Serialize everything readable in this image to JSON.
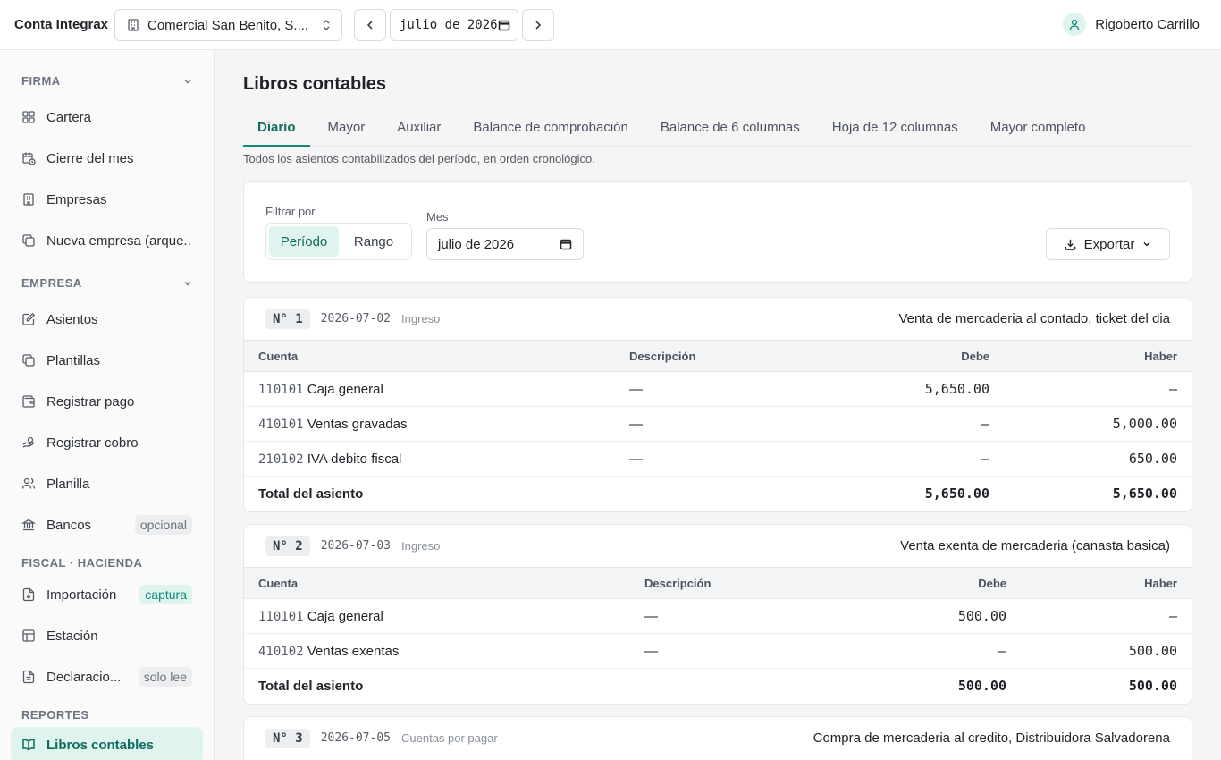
{
  "app": {
    "brand": "Conta Integrax"
  },
  "header": {
    "company": "Comercial San Benito, S....",
    "month_value": "julio de 2026",
    "user_name": "Rigoberto Carrillo"
  },
  "sidebar": {
    "sections": {
      "firma": "FIRMA",
      "empresa": "EMPRESA",
      "fiscal": "FISCAL · HACIENDA",
      "reportes": "REPORTES"
    },
    "items": {
      "cartera": {
        "label": "Cartera",
        "icon": "grid-icon"
      },
      "cierre": {
        "label": "Cierre del mes",
        "icon": "calendar-clock-icon"
      },
      "empresas": {
        "label": "Empresas",
        "icon": "building-icon"
      },
      "nueva": {
        "label": "Nueva empresa (arque...",
        "icon": "copy-icon"
      },
      "asientos": {
        "label": "Asientos",
        "icon": "edit-icon"
      },
      "plantillas": {
        "label": "Plantillas",
        "icon": "copy-icon"
      },
      "pago": {
        "label": "Registrar pago",
        "icon": "wallet-icon"
      },
      "cobro": {
        "label": "Registrar cobro",
        "icon": "hand-coins-icon"
      },
      "planilla": {
        "label": "Planilla",
        "icon": "users-icon"
      },
      "bancos": {
        "label": "Bancos",
        "badge": "opcional",
        "icon": "bank-icon"
      },
      "importacion": {
        "label": "Importación",
        "badge": "captura",
        "icon": "file-import-icon"
      },
      "estacion": {
        "label": "Estación",
        "icon": "table-icon"
      },
      "declaraciones": {
        "label": "Declaracio...",
        "badge": "solo lee",
        "icon": "file-text-icon"
      },
      "libros": {
        "label": "Libros contables",
        "icon": "book-open-icon"
      }
    }
  },
  "page": {
    "title": "Libros contables",
    "subtitle": "Todos los asientos contabilizados del período, en orden cronológico.",
    "tabs": [
      "Diario",
      "Mayor",
      "Auxiliar",
      "Balance de comprobación",
      "Balance de 6 columnas",
      "Hoja de 12 columnas",
      "Mayor completo"
    ],
    "active_tab": "Diario"
  },
  "filters": {
    "filter_label": "Filtrar por",
    "options": [
      "Período",
      "Rango"
    ],
    "selected": "Período",
    "month_label": "Mes",
    "month_value": "julio de 2026",
    "export_label": "Exportar"
  },
  "table_headers": {
    "cuenta": "Cuenta",
    "descripcion": "Descripción",
    "debe": "Debe",
    "haber": "Haber"
  },
  "entries": [
    {
      "number": "N° 1",
      "date": "2026-07-02",
      "type": "Ingreso",
      "description": "Venta de mercaderia al contado, ticket del dia",
      "lines": [
        {
          "code": "110101",
          "account": "Caja general",
          "desc": "—",
          "debe": "5,650.00",
          "haber": "—"
        },
        {
          "code": "410101",
          "account": "Ventas gravadas",
          "desc": "—",
          "debe": "—",
          "haber": "5,000.00"
        },
        {
          "code": "210102",
          "account": "IVA debito fiscal",
          "desc": "—",
          "debe": "—",
          "haber": "650.00"
        }
      ],
      "total_label": "Total del asiento",
      "total_debe": "5,650.00",
      "total_haber": "5,650.00"
    },
    {
      "number": "N° 2",
      "date": "2026-07-03",
      "type": "Ingreso",
      "description": "Venta exenta de mercaderia (canasta basica)",
      "lines": [
        {
          "code": "110101",
          "account": "Caja general",
          "desc": "—",
          "debe": "500.00",
          "haber": "—"
        },
        {
          "code": "410102",
          "account": "Ventas exentas",
          "desc": "—",
          "debe": "—",
          "haber": "500.00"
        }
      ],
      "total_label": "Total del asiento",
      "total_debe": "500.00",
      "total_haber": "500.00"
    },
    {
      "number": "N° 3",
      "date": "2026-07-05",
      "type": "Cuentas por pagar",
      "description": "Compra de mercaderia al credito, Distribuidora Salvadorena"
    }
  ],
  "colors": {
    "accent": "#0f8a78",
    "accent_bg": "#dff3ef"
  }
}
